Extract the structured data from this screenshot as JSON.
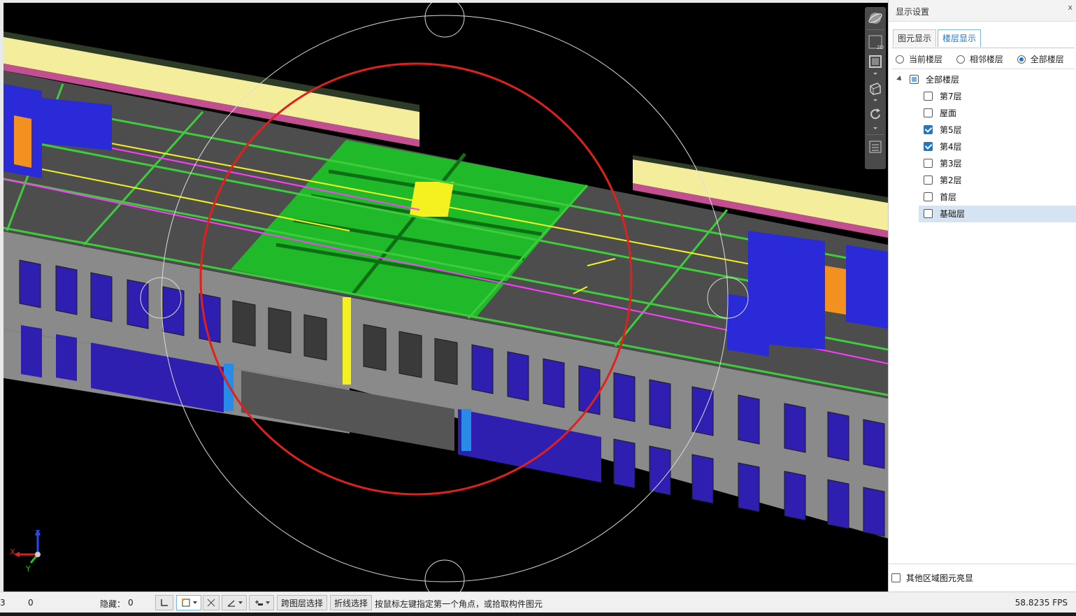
{
  "viewport": {
    "axis": {
      "x_label": "X",
      "y_label": "Y",
      "z_label": "Z"
    }
  },
  "view_toolbar": {
    "icons": [
      "orbit-icon",
      "2d-view-icon",
      "floor-plan-icon",
      "3d-box-icon",
      "rotate-icon",
      "settings-icon"
    ],
    "two_d_badge": "2D"
  },
  "panel": {
    "title": "显示设置",
    "close_glyph": "x",
    "tabs": [
      {
        "label": "图元显示",
        "active": false
      },
      {
        "label": "楼层显示",
        "active": true
      }
    ],
    "floor_scope": [
      {
        "label": "当前楼层",
        "selected": false
      },
      {
        "label": "相邻楼层",
        "selected": false
      },
      {
        "label": "全部楼层",
        "selected": true
      }
    ],
    "tree": {
      "root": {
        "label": "全部楼层",
        "state": "partial"
      },
      "items": [
        {
          "label": "第7层",
          "checked": false,
          "selected": false
        },
        {
          "label": "屋面",
          "checked": false,
          "selected": false
        },
        {
          "label": "第5层",
          "checked": true,
          "selected": false
        },
        {
          "label": "第4层",
          "checked": true,
          "selected": false
        },
        {
          "label": "第3层",
          "checked": false,
          "selected": false
        },
        {
          "label": "第2层",
          "checked": false,
          "selected": false
        },
        {
          "label": "首层",
          "checked": false,
          "selected": false
        },
        {
          "label": "基础层",
          "checked": false,
          "selected": true
        }
      ]
    },
    "highlight_other_areas": {
      "label": "其他区域图元亮显",
      "checked": false
    }
  },
  "statusbar": {
    "left_value_a": "3",
    "left_value_b": "0",
    "hidden_label": "隐藏：",
    "hidden_count": "0",
    "cross_floor_select": "跨图层选择",
    "polyline_select": "折线选择",
    "hint": "按鼠标左键指定第一个角点，或拾取构件图元",
    "fps": "58.8235 FPS"
  },
  "colors": {
    "accent": "#1e78c8",
    "selection_circle": "#e0201a",
    "beam_green": "#22c02a",
    "slab_gray": "#4a4a4a",
    "wall_gray": "#8c8c8c",
    "window_blue": "#2f1fb0",
    "parapet_yellow": "#f5ee9a"
  }
}
